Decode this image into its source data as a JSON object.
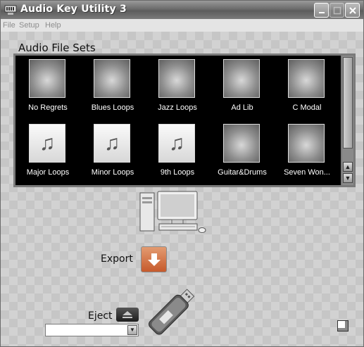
{
  "window": {
    "title": "Audio Key Utility 3",
    "controls": {
      "minimize": "minimize",
      "maximize": "maximize",
      "close": "close"
    }
  },
  "menu": {
    "items": [
      "File",
      "Setup",
      "Help"
    ]
  },
  "audio_file_sets": {
    "title": "Audio File Sets",
    "items": [
      {
        "label": "No Regrets",
        "thumbnail": "photo"
      },
      {
        "label": "Blues Loops",
        "thumbnail": "photo"
      },
      {
        "label": "Jazz Loops",
        "thumbnail": "photo"
      },
      {
        "label": "Ad Lib",
        "thumbnail": "photo"
      },
      {
        "label": "C Modal",
        "thumbnail": "photo"
      },
      {
        "label": "Major Loops",
        "thumbnail": "music-notes"
      },
      {
        "label": "Minor Loops",
        "thumbnail": "music-notes"
      },
      {
        "label": "9th Loops",
        "thumbnail": "music-notes"
      },
      {
        "label": "Guitar&Drums",
        "thumbnail": "photo"
      },
      {
        "label": "Seven Won...",
        "thumbnail": "photo"
      }
    ]
  },
  "transfer": {
    "computer_icon": "computer-icon",
    "export_label": "Export",
    "export_icon": "down-arrow-icon",
    "usb_icon": "usb-key-icon"
  },
  "eject": {
    "label": "Eject",
    "icon": "eject-icon",
    "drive_value": ""
  },
  "colors": {
    "titlebar": "#6c6c6c",
    "sets_background": "#000000",
    "export_button": "#d4713f"
  }
}
